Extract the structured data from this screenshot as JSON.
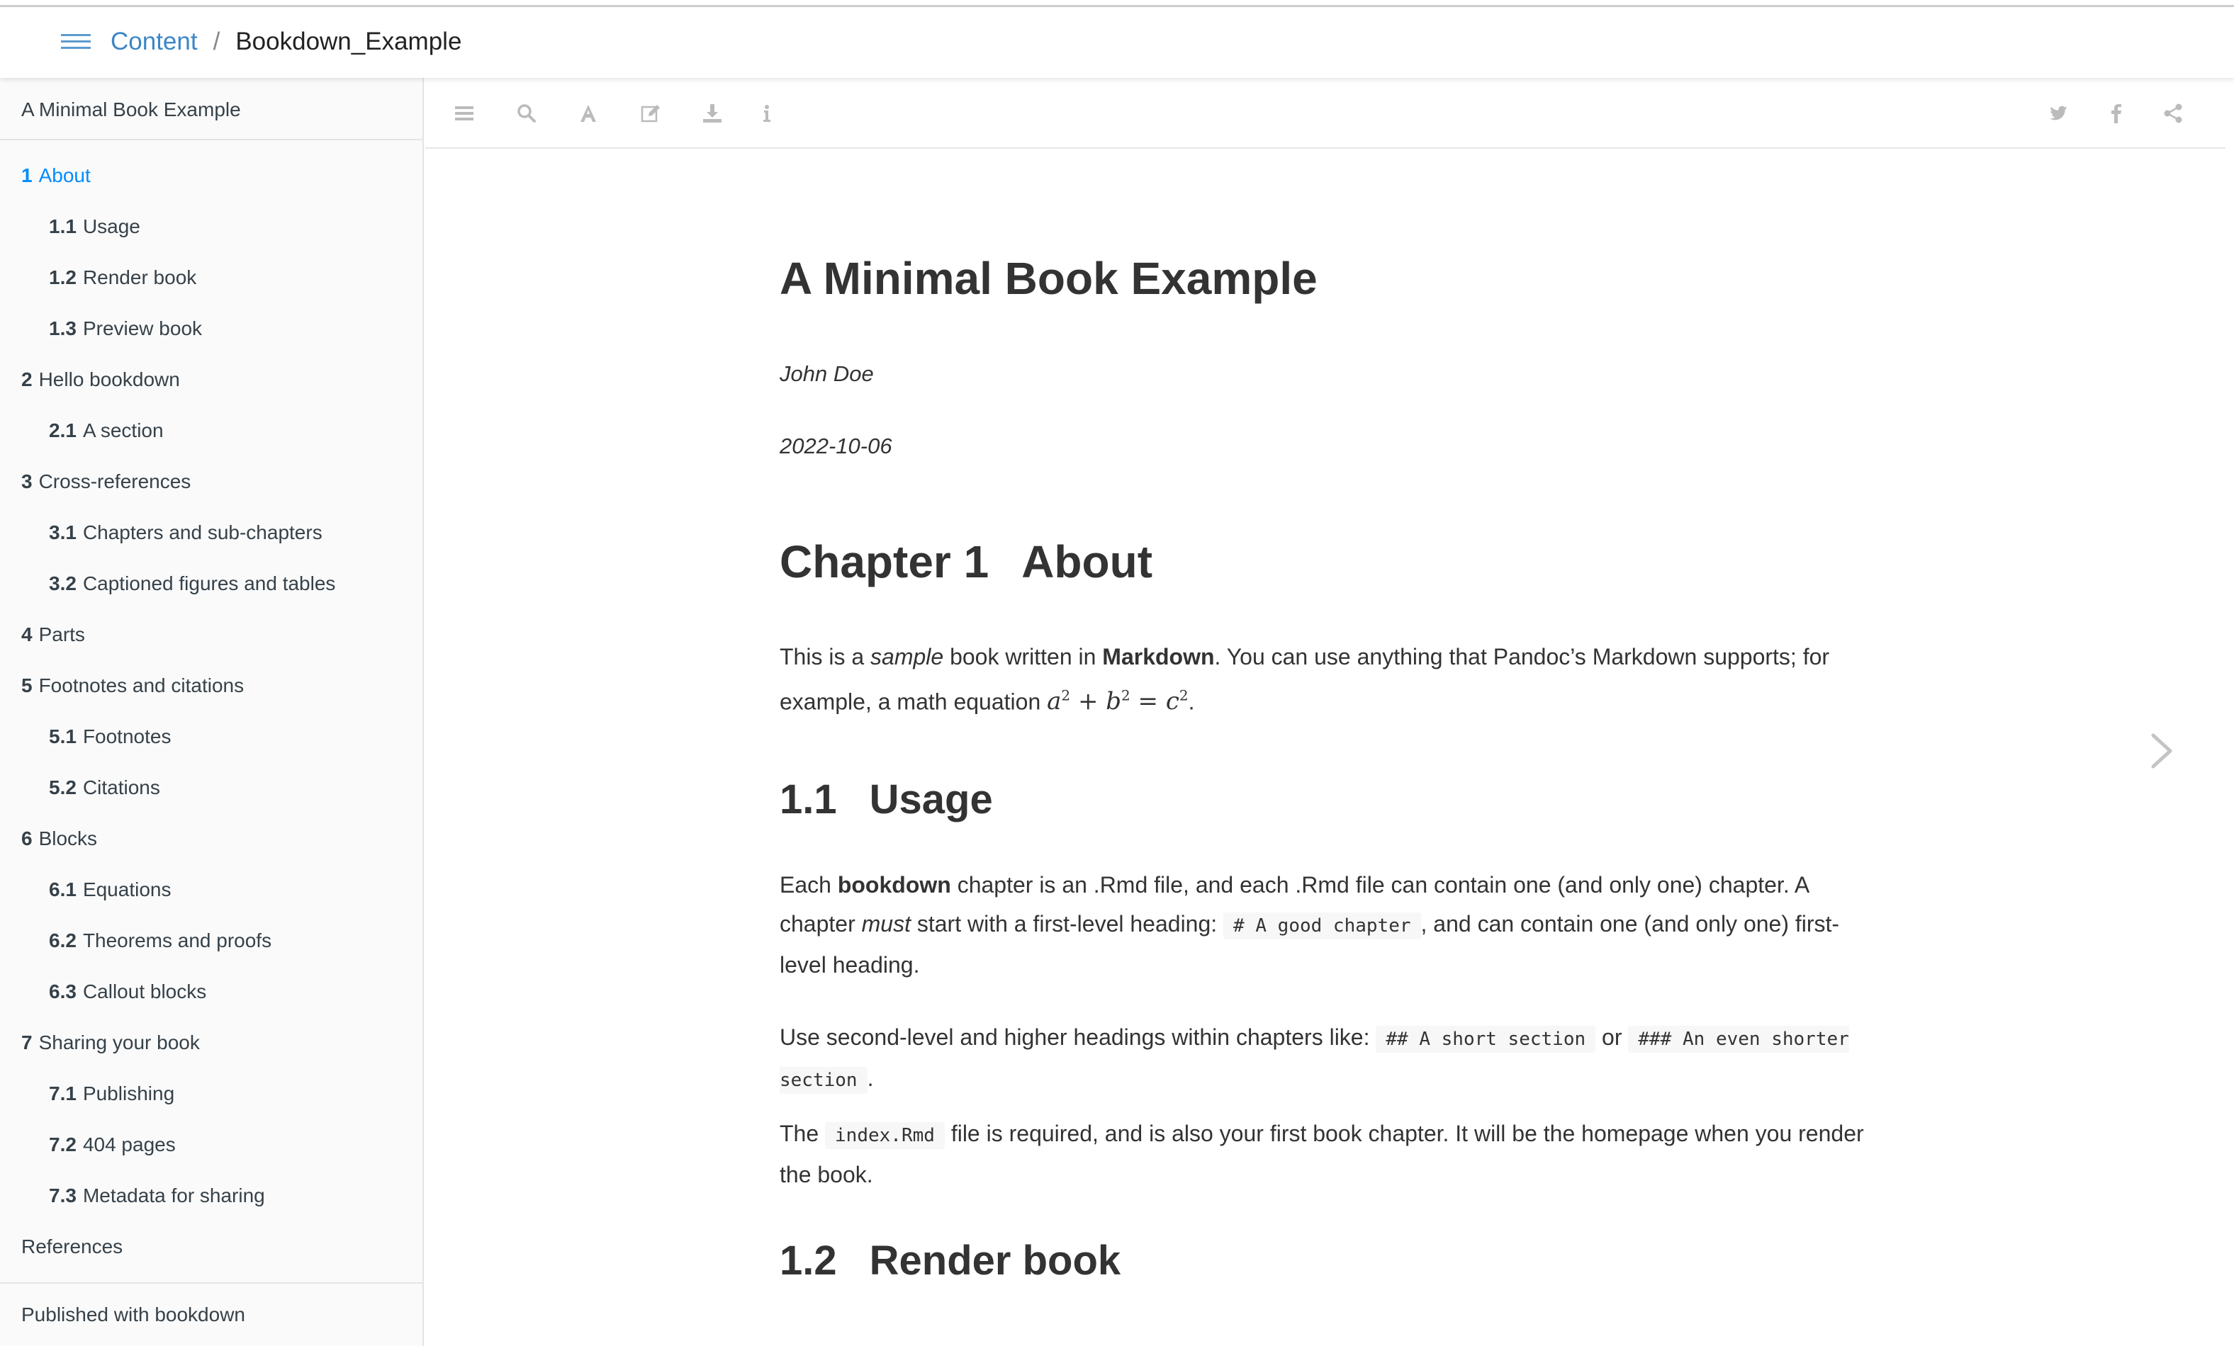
{
  "header": {
    "crumb_link": "Content",
    "separator": "/",
    "crumb_current": "Bookdown_Example"
  },
  "sidebar": {
    "title": "A Minimal Book Example",
    "items": [
      {
        "num": "1",
        "label": "About",
        "level": 1,
        "active": true
      },
      {
        "num": "1.1",
        "label": "Usage",
        "level": 2
      },
      {
        "num": "1.2",
        "label": "Render book",
        "level": 2
      },
      {
        "num": "1.3",
        "label": "Preview book",
        "level": 2
      },
      {
        "num": "2",
        "label": "Hello bookdown",
        "level": 1
      },
      {
        "num": "2.1",
        "label": "A section",
        "level": 2
      },
      {
        "num": "3",
        "label": "Cross-references",
        "level": 1
      },
      {
        "num": "3.1",
        "label": "Chapters and sub-chapters",
        "level": 2
      },
      {
        "num": "3.2",
        "label": "Captioned figures and tables",
        "level": 2
      },
      {
        "num": "4",
        "label": "Parts",
        "level": 1
      },
      {
        "num": "5",
        "label": "Footnotes and citations",
        "level": 1
      },
      {
        "num": "5.1",
        "label": "Footnotes",
        "level": 2
      },
      {
        "num": "5.2",
        "label": "Citations",
        "level": 2
      },
      {
        "num": "6",
        "label": "Blocks",
        "level": 1
      },
      {
        "num": "6.1",
        "label": "Equations",
        "level": 2
      },
      {
        "num": "6.2",
        "label": "Theorems and proofs",
        "level": 2
      },
      {
        "num": "6.3",
        "label": "Callout blocks",
        "level": 2
      },
      {
        "num": "7",
        "label": "Sharing your book",
        "level": 1
      },
      {
        "num": "7.1",
        "label": "Publishing",
        "level": 2
      },
      {
        "num": "7.2",
        "label": "404 pages",
        "level": 2
      },
      {
        "num": "7.3",
        "label": "Metadata for sharing",
        "level": 2
      },
      {
        "num": "",
        "label": "References",
        "level": 1
      }
    ],
    "footer": "Published with bookdown"
  },
  "toolbar": {
    "left_icons": [
      "toc-toggle-icon",
      "search-icon",
      "font-settings-icon",
      "edit-icon",
      "download-icon",
      "info-icon"
    ],
    "right_icons": [
      "twitter-icon",
      "facebook-icon",
      "share-icon"
    ]
  },
  "content": {
    "book_title": "A Minimal Book Example",
    "author": "John Doe",
    "date": "2022-10-06",
    "chapter_num": "Chapter 1",
    "chapter_title": "About",
    "about_p1": "This is a ",
    "about_p1_em": "sample",
    "about_p1_b": " book written in ",
    "about_p1_strong": "Markdown",
    "about_p1_c": ". You can use anything that Pandoc’s Markdown supports; for example, a math equation ",
    "math_a": "a",
    "math_b": "b",
    "math_c": "c",
    "math_exp": "2",
    "about_p1_end": ".",
    "usage_num": "1.1",
    "usage_title": "Usage",
    "usage_p1_a": "Each ",
    "usage_p1_strong": "bookdown",
    "usage_p1_b": " chapter is an .Rmd file, and each .Rmd file can contain one (and only one) chapter. A chapter ",
    "usage_p1_em": "must",
    "usage_p1_c": " start with a first-level heading: ",
    "usage_p1_code": "# A good chapter",
    "usage_p1_d": ", and can contain one (and only one) first-level heading.",
    "usage_p2_a": "Use second-level and higher headings within chapters like: ",
    "usage_p2_code1": "## A short section",
    "usage_p2_b": " or ",
    "usage_p2_code2": "### An even shorter section",
    "usage_p2_c": ".",
    "usage_p3_a": "The ",
    "usage_p3_code": "index.Rmd",
    "usage_p3_b": " file is required, and is also your first book chapter. It will be the homepage when you render the book.",
    "render_num": "1.2",
    "render_title": "Render book"
  },
  "colors": {
    "link": "#3d86c6",
    "active_toc": "#008cff",
    "icon_grey": "#bbbbbb"
  }
}
